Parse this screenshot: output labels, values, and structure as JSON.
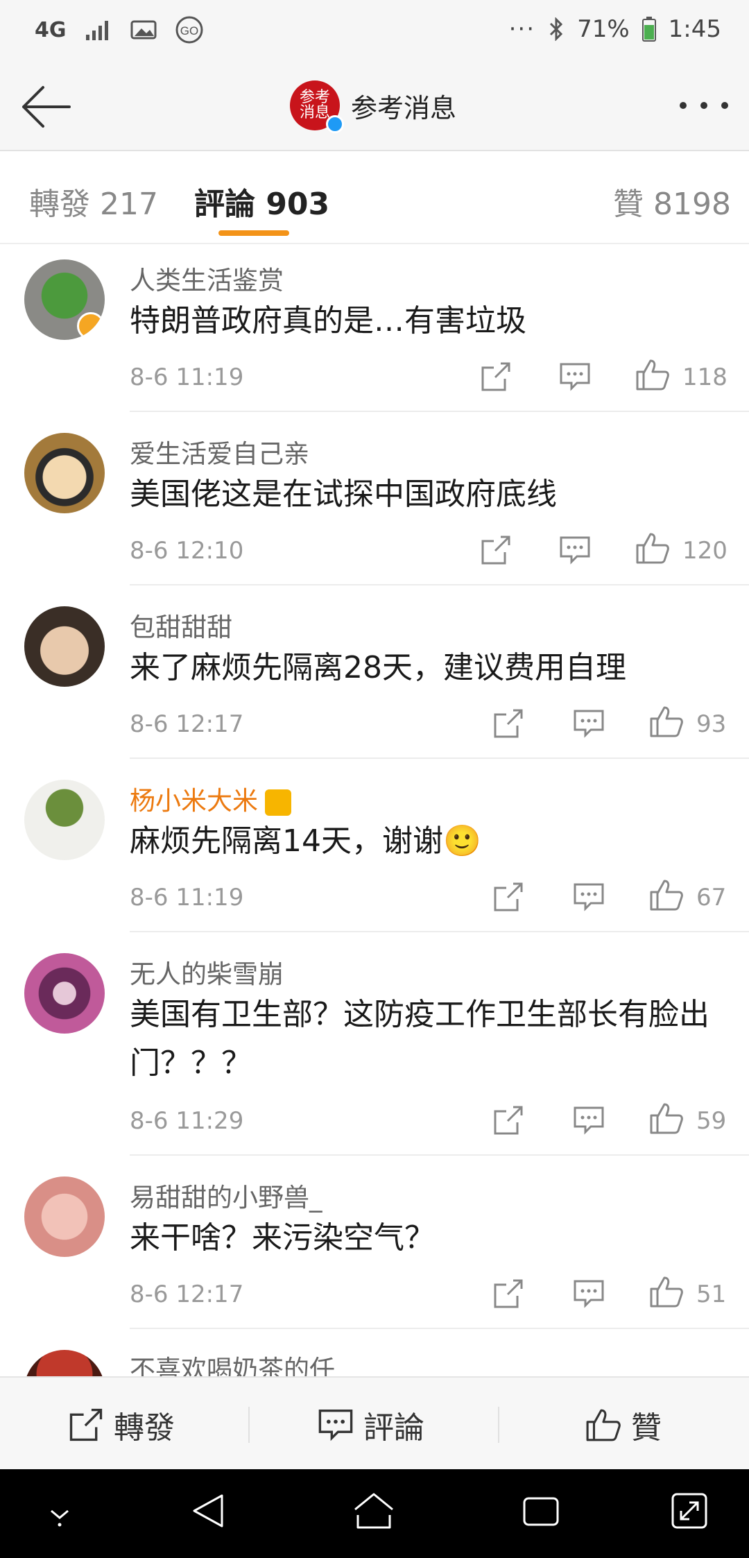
{
  "status_bar": {
    "network": "4G",
    "battery": "71%",
    "time": "1:45"
  },
  "nav": {
    "title": "参考消息",
    "logo_text": "参考消息"
  },
  "tabs": [
    {
      "label": "轉發 217"
    },
    {
      "label": "評論 903"
    },
    {
      "label": "贊 8198"
    }
  ],
  "comments": [
    {
      "name": "人类生活鉴赏",
      "text": "特朗普政府真的是…有害垃圾",
      "time": "8-6 11:19",
      "likes": "118"
    },
    {
      "name": "爱生活爱自己亲",
      "text": "美国佬这是在试探中国政府底线",
      "time": "8-6 12:10",
      "likes": "120"
    },
    {
      "name": "包甜甜甜",
      "text": "来了麻烦先隔离28天，建议费用自理",
      "time": "8-6 12:17",
      "likes": "93"
    },
    {
      "name": "杨小米大米",
      "text": "麻烦先隔离14天，谢谢🙂",
      "time": "8-6 11:19",
      "likes": "67"
    },
    {
      "name": "无人的柴雪崩",
      "text": "美国有卫生部？这防疫工作卫生部长有脸出门？？？",
      "time": "8-6 11:29",
      "likes": "59"
    },
    {
      "name": "易甜甜的小野兽_",
      "text": "来干啥？来污染空气？",
      "time": "8-6 12:17",
      "likes": "51"
    },
    {
      "name": "不喜欢喝奶茶的任",
      "text": "",
      "time": "",
      "likes": ""
    }
  ],
  "bottom_bar": {
    "repost": "轉發",
    "comment": "評論",
    "like": "贊"
  },
  "colors": {
    "accent": "#f39318",
    "name_vip": "#ec7a10",
    "verify": "#1e9af5"
  }
}
